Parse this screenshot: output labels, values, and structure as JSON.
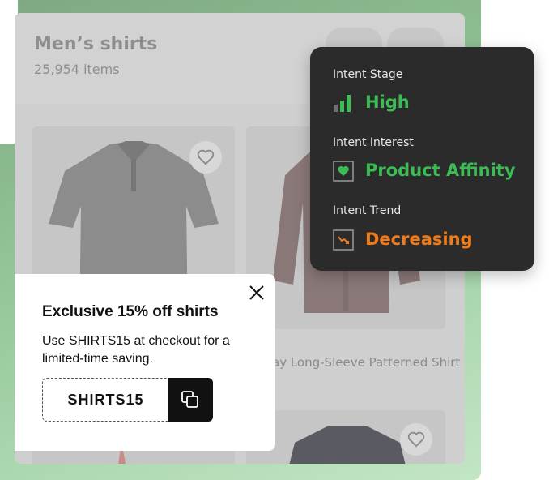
{
  "shop": {
    "title": "Men’s shirts",
    "item_count": "25,954 items",
    "product_name": "ay Long-Sleeve Patterned Shirt"
  },
  "intent": {
    "stage_label": "Intent Stage",
    "stage_value": "High",
    "interest_label": "Intent Interest",
    "interest_value": "Product Affinity",
    "trend_label": "Intent Trend",
    "trend_value": "Decreasing",
    "colors": {
      "positive": "#3dbb57",
      "negative": "#f07b18"
    },
    "icons": [
      "bar-chart-icon",
      "heart-box-icon",
      "trend-down-icon"
    ]
  },
  "promo": {
    "title": "Exclusive 15% off shirts",
    "body": "Use SHIRTS15 at checkout for a limited-time saving.",
    "code": "SHIRTS15",
    "icons": [
      "close-icon",
      "copy-icon"
    ]
  }
}
